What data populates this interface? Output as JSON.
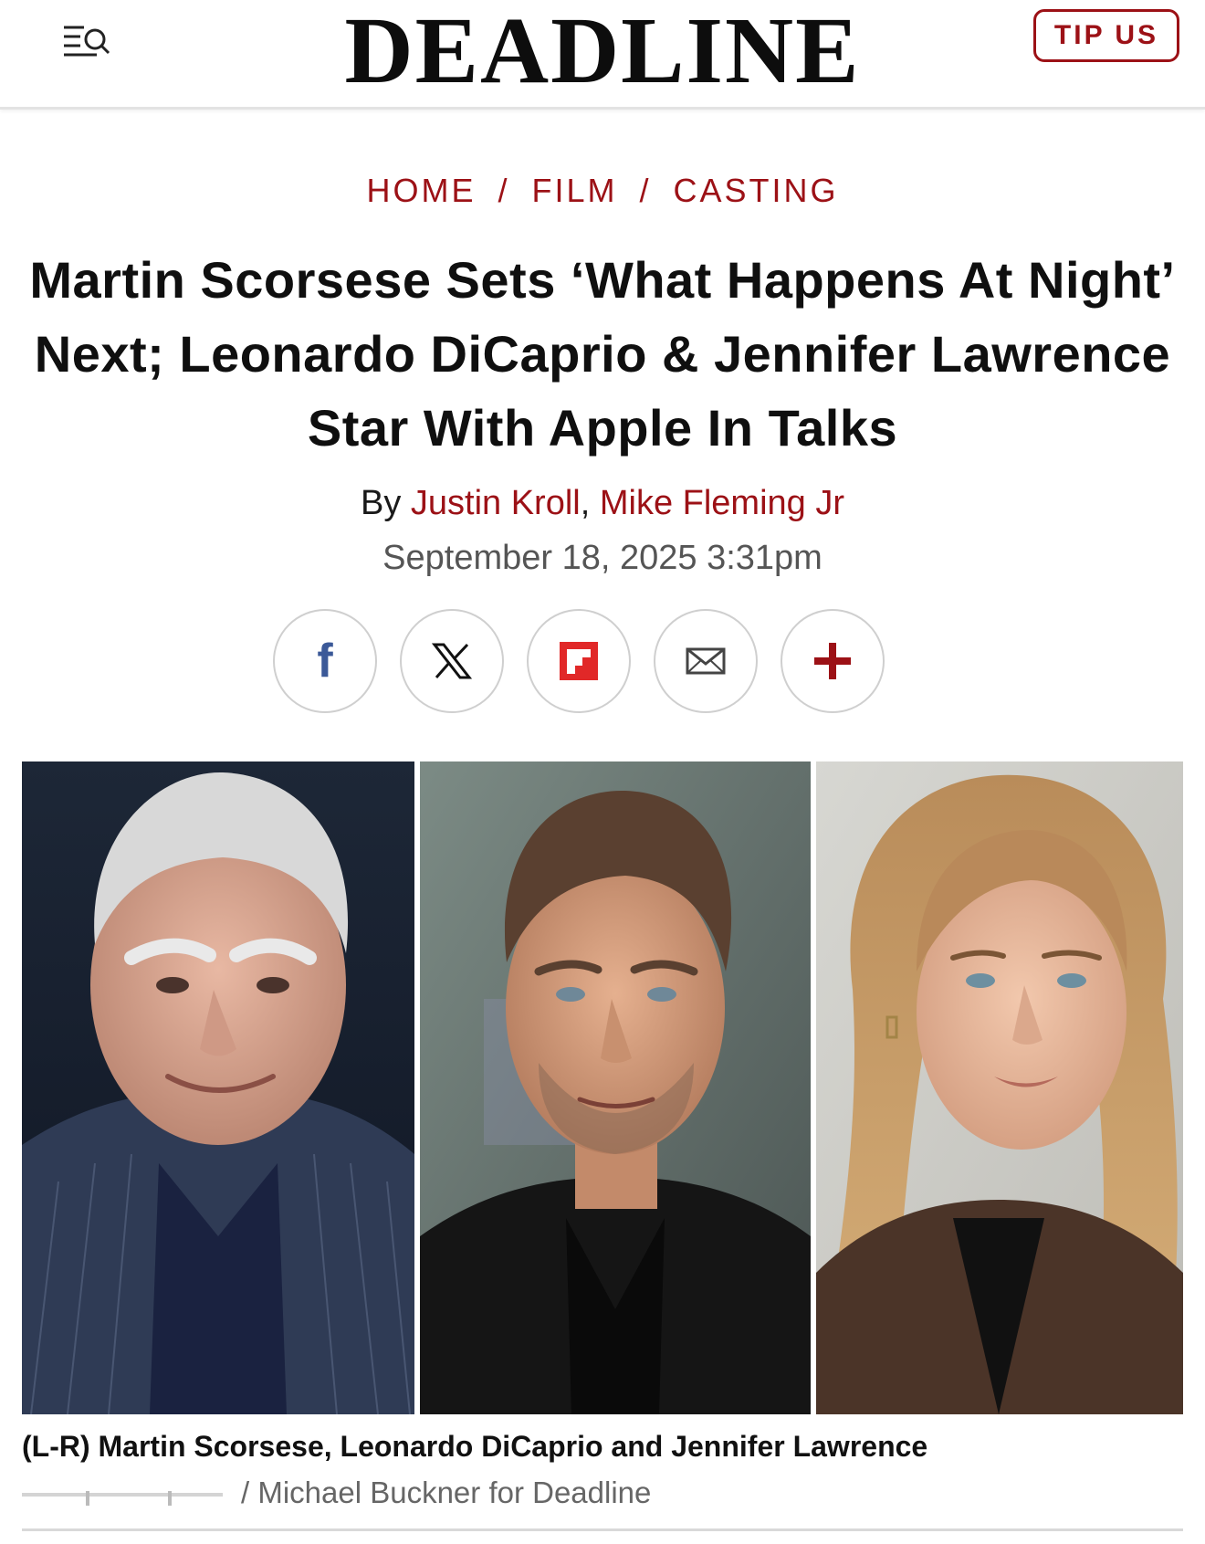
{
  "header": {
    "logo": "DEADLINE",
    "tip_button": "TIP US",
    "menu_icon": "menu-search-icon"
  },
  "breadcrumb": {
    "items": [
      "HOME",
      "FILM",
      "CASTING"
    ],
    "separator": "/"
  },
  "article": {
    "headline": "Martin Scorsese Sets ‘What Happens At Night’ Next; Leonardo DiCaprio & Jennifer Lawrence Star With Apple In Talks",
    "by_prefix": "By",
    "authors": [
      "Justin Kroll",
      "Mike Fleming Jr"
    ],
    "author_separator": ",",
    "date": "September 18, 2025 3:31pm"
  },
  "share": {
    "buttons": [
      {
        "icon": "facebook-icon",
        "label": "f"
      },
      {
        "icon": "x-icon",
        "label": "X"
      },
      {
        "icon": "flipboard-icon",
        "label": ""
      },
      {
        "icon": "email-icon",
        "label": ""
      },
      {
        "icon": "plus-icon",
        "label": "+"
      }
    ]
  },
  "photo": {
    "caption": "(L-R) Martin Scorsese, Leonardo DiCaprio and Jennifer Lawrence",
    "credit": "/ Michael Buckner for Deadline"
  },
  "colors": {
    "accent": "#9c1116",
    "text": "#111111",
    "muted": "#555555"
  }
}
